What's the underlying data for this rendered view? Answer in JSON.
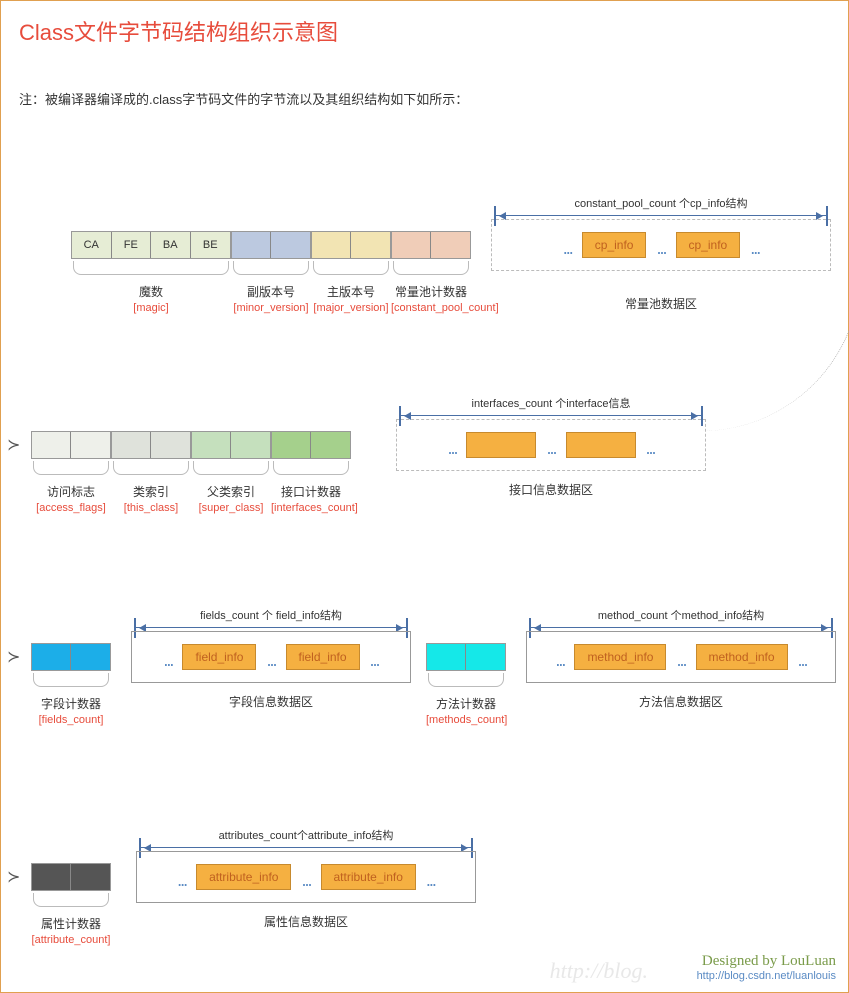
{
  "title": "Class文件字节码结构组织示意图",
  "note": "注：被编译器编译成的.class字节码文件的字节流以及其组织结构如下如所示：",
  "row1": {
    "magic": {
      "label": "魔数",
      "key": "[magic]",
      "bytes": [
        "CA",
        "FE",
        "BA",
        "BE"
      ]
    },
    "minor": {
      "label": "副版本号",
      "key": "[minor_version]"
    },
    "major": {
      "label": "主版本号",
      "key": "[major_version]"
    },
    "cpc": {
      "label": "常量池计数器",
      "key": "[constant_pool_count]"
    },
    "pool": {
      "arrow": "constant_pool_count 个cp_info结构",
      "label": "常量池数据区",
      "chip": "cp_info",
      "dots": "..."
    }
  },
  "row2": {
    "af": {
      "label": "访问标志",
      "key": "[access_flags]"
    },
    "tc": {
      "label": "类索引",
      "key": "[this_class]"
    },
    "sc": {
      "label": "父类索引",
      "key": "[super_class]"
    },
    "ic": {
      "label": "接口计数器",
      "key": "[interfaces_count]"
    },
    "pool": {
      "arrow": "interfaces_count 个interface信息",
      "label": "接口信息数据区",
      "dots": "..."
    }
  },
  "row3": {
    "fc": {
      "label": "字段计数器",
      "key": "[fields_count]"
    },
    "fpool": {
      "arrow": "fields_count 个 field_info结构",
      "label": "字段信息数据区",
      "chip": "field_info",
      "dots": "..."
    },
    "mc": {
      "label": "方法计数器",
      "key": "[methods_count]"
    },
    "mpool": {
      "arrow": "method_count 个method_info结构",
      "label": "方法信息数据区",
      "chip": "method_info",
      "dots": "..."
    }
  },
  "row4": {
    "ac": {
      "label": "属性计数器",
      "key": "[attribute_count]"
    },
    "apool": {
      "arrow": "attributes_count个attribute_info结构",
      "label": "属性信息数据区",
      "chip": "attribute_info",
      "dots": "..."
    }
  },
  "signature": {
    "author": "Designed by LouLuan",
    "url": "http://blog.csdn.net/luanlouis"
  },
  "watermark": "http://blog."
}
